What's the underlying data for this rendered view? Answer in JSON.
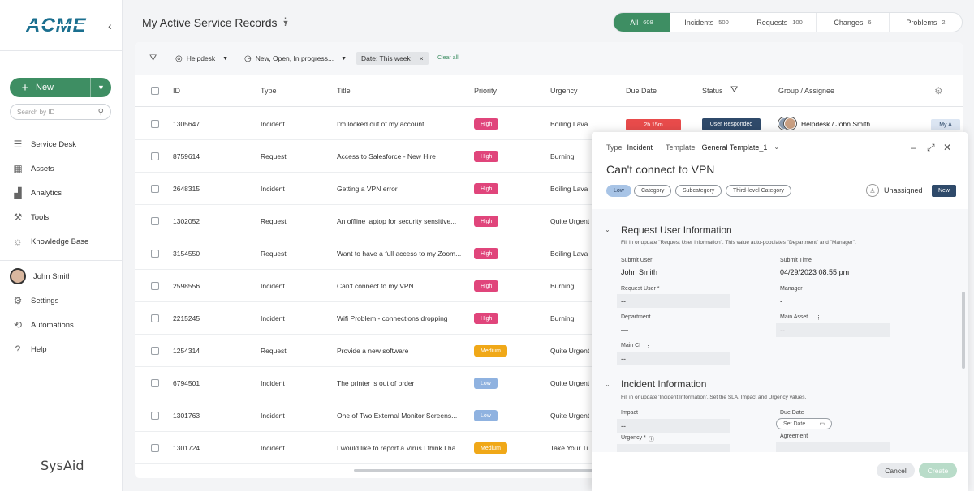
{
  "brand": {
    "logo_text": "ACME",
    "footer_logo": "SysAid"
  },
  "sidebar": {
    "new_label": "New",
    "search_placeholder": "Search by ID",
    "nav": [
      {
        "label": "Service Desk",
        "icon": "service-desk-icon"
      },
      {
        "label": "Assets",
        "icon": "assets-icon"
      },
      {
        "label": "Analytics",
        "icon": "analytics-icon"
      },
      {
        "label": "Tools",
        "icon": "tools-icon"
      },
      {
        "label": "Knowledge Base",
        "icon": "bulb-icon"
      }
    ],
    "user": "John Smith",
    "bottom": [
      {
        "label": "Settings",
        "icon": "gear-icon"
      },
      {
        "label": "Automations",
        "icon": "automations-icon"
      },
      {
        "label": "Help",
        "icon": "help-icon"
      }
    ]
  },
  "header": {
    "title": "My Active Service Records",
    "tabs": [
      {
        "label": "All",
        "count": "608",
        "active": true
      },
      {
        "label": "Incidents",
        "count": "500"
      },
      {
        "label": "Requests",
        "count": "100"
      },
      {
        "label": "Changes",
        "count": "6"
      },
      {
        "label": "Problems",
        "count": "2"
      }
    ]
  },
  "filters": {
    "helpdesk": "Helpdesk",
    "status": "New, Open, In progress...",
    "date": "Date: This week",
    "clear": "Clear all"
  },
  "columns": [
    "ID",
    "Type",
    "Title",
    "Priority",
    "Urgency",
    "Due Date",
    "Status",
    "Group / Assignee"
  ],
  "rows": [
    {
      "id": "1305647",
      "type": "Incident",
      "title": "I'm locked out of my account",
      "priority": "High",
      "urgency": "Boiling Lava"
    },
    {
      "id": "8759614",
      "type": "Request",
      "title": "Access to Salesforce - New Hire",
      "priority": "High",
      "urgency": "Burning"
    },
    {
      "id": "2648315",
      "type": "Incident",
      "title": "Getting a VPN error",
      "priority": "High",
      "urgency": "Boiling Lava"
    },
    {
      "id": "1302052",
      "type": "Request",
      "title": "An offline laptop for security sensitive...",
      "priority": "High",
      "urgency": "Quite Urgent"
    },
    {
      "id": "3154550",
      "type": "Request",
      "title": "Want to have a full access to my Zoom...",
      "priority": "High",
      "urgency": "Boiling Lava"
    },
    {
      "id": "2598556",
      "type": "Incident",
      "title": "Can't connect to my VPN",
      "priority": "High",
      "urgency": "Burning"
    },
    {
      "id": "2215245",
      "type": "Incident",
      "title": "Wifi Problem - connections dropping",
      "priority": "High",
      "urgency": "Burning"
    },
    {
      "id": "1254314",
      "type": "Request",
      "title": "Provide a new software",
      "priority": "Medium",
      "urgency": "Quite Urgent"
    },
    {
      "id": "6794501",
      "type": "Incident",
      "title": "The printer is out of order",
      "priority": "Low",
      "urgency": "Quite Urgent"
    },
    {
      "id": "1301763",
      "type": "Incident",
      "title": "One of Two External Monitor Screens...",
      "priority": "Low",
      "urgency": "Quite Urgent"
    },
    {
      "id": "1301724",
      "type": "Incident",
      "title": "I would like to report a Virus I think I ha...",
      "priority": "Medium",
      "urgency": "Take Your Ti"
    }
  ],
  "first_row_extra": {
    "due": "2h 15m",
    "status": "User Responded",
    "group": "Helpdesk / John Smith",
    "badge": "My A"
  },
  "colors": {
    "accent": "#3e8e63",
    "high": "#e0457b",
    "medium": "#f0a818",
    "low": "#8fb2e0"
  },
  "panel": {
    "type_label": "Type",
    "type_value": "Incident",
    "template_label": "Template",
    "template_value": "General Template_1",
    "title": "Can't connect to VPN",
    "chips": [
      "Low",
      "Category",
      "Subcategory",
      "Third-level Category"
    ],
    "assignee": "Unassigned",
    "status_badge": "New",
    "section1": {
      "title": "Request User Information",
      "desc": "Fill in or update \"Request User Information\". This value auto-populates \"Department\" and \"Manager\".",
      "submit_user_label": "Submit User",
      "submit_user": "John Smith",
      "submit_time_label": "Submit Time",
      "submit_time": "04/29/2023 08:55 pm",
      "request_user_label": "Request User *",
      "request_user": "--",
      "manager_label": "Manager",
      "manager": "-",
      "department_label": "Department",
      "department": "—",
      "main_asset_label": "Main Asset",
      "main_asset": "--",
      "main_ci_label": "Main CI",
      "main_ci": "--"
    },
    "section2": {
      "title": "Incident Information",
      "desc": "Fill in or update 'Incident Information'. Set the SLA, Impact and Urgency values.",
      "impact_label": "Impact",
      "impact": "--",
      "due_label": "Due Date",
      "due_placeholder": "Set Date",
      "urgency_label": "Urgency *",
      "agreement_label": "Agreement"
    },
    "cancel": "Cancel",
    "create": "Create"
  }
}
